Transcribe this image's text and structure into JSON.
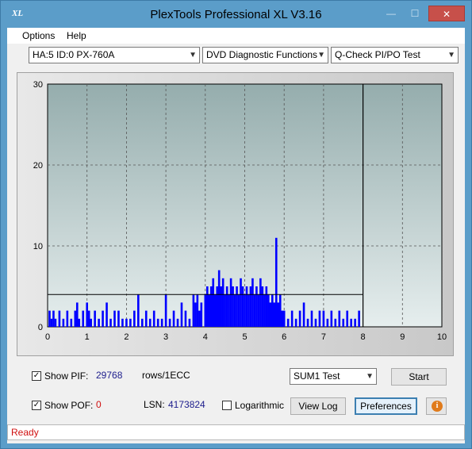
{
  "window": {
    "title": "PlexTools Professional XL V3.16",
    "icon_label": "XL",
    "min": "—",
    "max": "☐",
    "close": "✕"
  },
  "menu": [
    {
      "label": "Options"
    },
    {
      "label": "Help"
    }
  ],
  "toolbar": {
    "drive": "HA:5 ID:0  PX-760A",
    "function": "DVD Diagnostic Functions",
    "test": "Q-Check PI/PO Test"
  },
  "chart_data": {
    "type": "bar",
    "xlim": [
      0,
      10
    ],
    "ylim": [
      0,
      30
    ],
    "x_ticks": [
      "0",
      "1",
      "2",
      "3",
      "4",
      "5",
      "6",
      "7",
      "8",
      "9",
      "10"
    ],
    "y_ticks": [
      "0",
      "10",
      "20",
      "30"
    ],
    "threshold": 4,
    "end_marker_x": 8,
    "grid": true,
    "series": [
      {
        "color": "#0000ff",
        "x": [
          0.05,
          0.1,
          0.15,
          0.2,
          0.3,
          0.4,
          0.5,
          0.6,
          0.7,
          0.75,
          0.8,
          0.9,
          1.0,
          1.05,
          1.1,
          1.2,
          1.3,
          1.4,
          1.5,
          1.6,
          1.7,
          1.8,
          1.9,
          2.0,
          2.1,
          2.2,
          2.3,
          2.4,
          2.5,
          2.6,
          2.7,
          2.8,
          2.9,
          3.0,
          3.1,
          3.2,
          3.3,
          3.4,
          3.5,
          3.6,
          3.7,
          3.75,
          3.8,
          3.85,
          3.9,
          4.0,
          4.05,
          4.1,
          4.15,
          4.2,
          4.25,
          4.3,
          4.35,
          4.4,
          4.45,
          4.5,
          4.55,
          4.6,
          4.65,
          4.7,
          4.75,
          4.8,
          4.85,
          4.9,
          4.95,
          5.0,
          5.05,
          5.1,
          5.15,
          5.2,
          5.25,
          5.3,
          5.35,
          5.4,
          5.45,
          5.5,
          5.55,
          5.6,
          5.65,
          5.7,
          5.75,
          5.8,
          5.85,
          5.9,
          5.95,
          6.0,
          6.1,
          6.2,
          6.3,
          6.4,
          6.5,
          6.6,
          6.7,
          6.8,
          6.9,
          7.0,
          7.1,
          7.2,
          7.3,
          7.4,
          7.5,
          7.6,
          7.7,
          7.8,
          7.9
        ],
        "values": [
          2,
          1,
          2,
          1,
          2,
          1,
          2,
          1,
          2,
          3,
          1,
          2,
          3,
          2,
          1,
          2,
          1,
          2,
          3,
          1,
          2,
          2,
          1,
          1,
          1,
          2,
          4,
          1,
          2,
          1,
          2,
          1,
          1,
          4,
          1,
          2,
          1,
          3,
          2,
          1,
          4,
          3,
          4,
          2,
          3,
          4,
          5,
          4,
          5,
          6,
          4,
          5,
          7,
          5,
          6,
          4,
          5,
          4,
          6,
          5,
          4,
          5,
          4,
          6,
          5,
          4,
          5,
          4,
          5,
          6,
          4,
          5,
          4,
          6,
          5,
          4,
          5,
          4,
          3,
          4,
          3,
          11,
          3,
          4,
          2,
          2,
          1,
          2,
          1,
          2,
          3,
          1,
          2,
          1,
          2,
          2,
          1,
          2,
          1,
          2,
          1,
          2,
          1,
          1,
          2
        ]
      }
    ]
  },
  "controls": {
    "show_pif_label": "Show PIF:",
    "pif_value": "29768",
    "pif_unit": "rows/1ECC",
    "show_pof_label": "Show POF:",
    "pof_value": "0",
    "lsn_label": "LSN:",
    "lsn_value": "4173824",
    "log_label": "Logarithmic",
    "sum_select": "SUM1 Test",
    "start": "Start",
    "view_log": "View Log",
    "preferences": "Preferences",
    "check_mark": "✓",
    "info_icon": "i"
  },
  "status": {
    "text": "Ready"
  }
}
